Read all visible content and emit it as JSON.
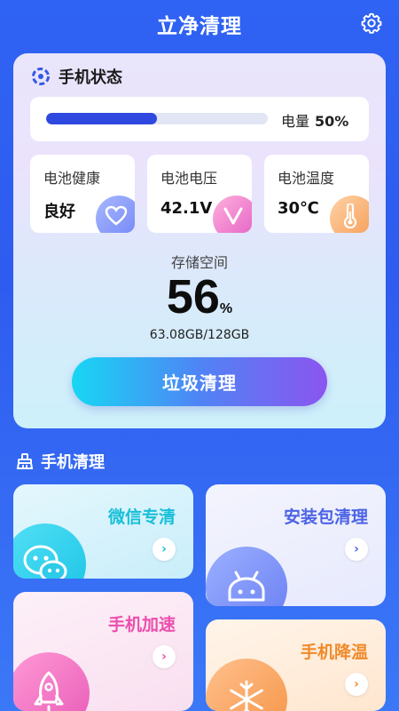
{
  "header": {
    "title": "立净清理",
    "settings_icon": "gear-icon"
  },
  "status_card": {
    "title": "手机状态",
    "power": {
      "label": "电量",
      "value": "50%",
      "level": 0.5
    },
    "tiles": [
      {
        "label": "电池健康",
        "value": "良好",
        "icon": "heart-icon"
      },
      {
        "label": "电池电压",
        "value": "42.1V",
        "icon": "voltage-v-icon"
      },
      {
        "label": "电池温度",
        "value": "30℃",
        "icon": "thermometer-icon"
      }
    ],
    "storage": {
      "label": "存储空间",
      "percent": "56",
      "percent_unit": "%",
      "detail": "63.08GB/128GB"
    },
    "clean_button": "垃圾清理"
  },
  "phone_clean": {
    "title": "手机清理",
    "items": [
      {
        "label": "微信专清",
        "icon": "wechat-icon",
        "color": "#17bfd8"
      },
      {
        "label": "安装包清理",
        "icon": "android-icon",
        "color": "#4c63e6"
      },
      {
        "label": "手机加速",
        "icon": "rocket-icon",
        "color": "#ec4fae"
      },
      {
        "label": "手机降温",
        "icon": "snowflake-icon",
        "color": "#f08a2a"
      }
    ]
  }
}
